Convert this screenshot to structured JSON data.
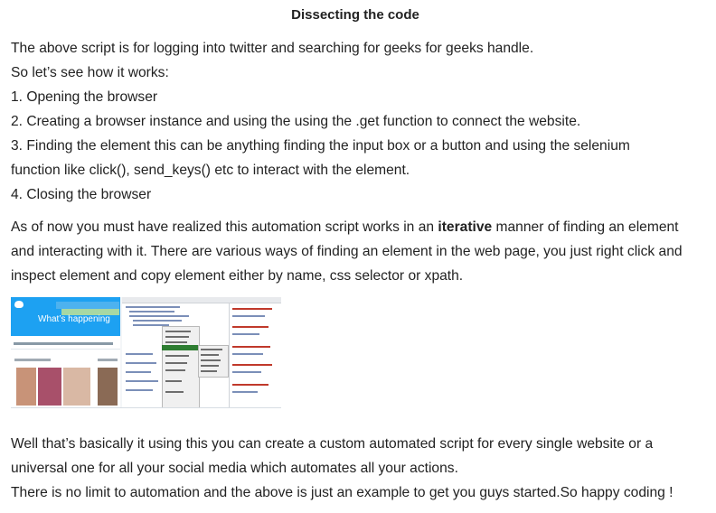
{
  "article": {
    "title": "Dissecting the code",
    "intro_lines": [
      "The above script is for logging into twitter and searching for geeks for geeks handle.",
      "So let’s see how it works:",
      "1. Opening the browser",
      "2. Creating a browser instance and using the using the .get function to connect the website.",
      "3. Finding the element this can be anything finding the input box or a button and using the selenium",
      "function like click(), send_keys() etc to interact with the element.",
      "4. Closing the browser"
    ],
    "paragraph2": {
      "before_bold": "As of now you must have realized this automation script works in an ",
      "bold": "iterative",
      "after_bold_line1": " manner of finding an element",
      "line2": "and interacting with it. There are various ways of finding an element in the web page, you just right click and",
      "line3": "inspect element and copy element either by name, css selector or xpath."
    },
    "screenshot": {
      "twitter_headline": "What’s happening",
      "colors": {
        "twitter_blue": "#1da1f2",
        "menu_highlight": "#2e7d32"
      }
    },
    "paragraph3_lines": [
      "Well that’s basically it using this you can create a custom automated script for every single website or a",
      "universal one for all your social media which automates all your actions.",
      "There is no limit to automation and the above is just an example to get you guys started.So happy coding !"
    ]
  }
}
